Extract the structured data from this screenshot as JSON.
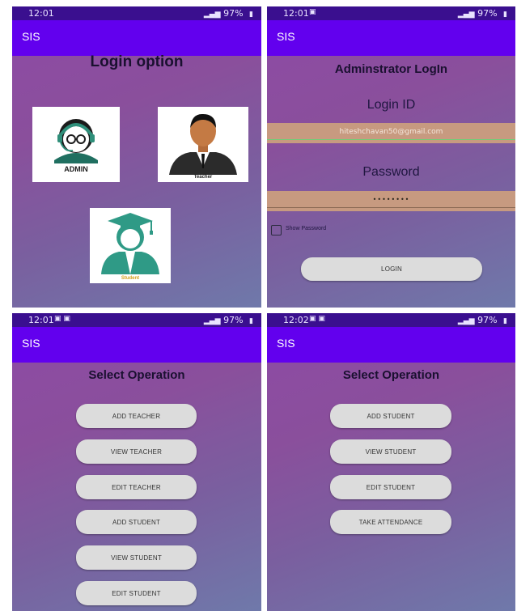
{
  "colors": {
    "status_bar": "#3a0f8f",
    "app_bar": "#6200ee",
    "button_bg": "#dcdcdc",
    "field_bg": "#c79a80",
    "admin_green": "#2f8f7a"
  },
  "screens": [
    {
      "status": {
        "time": "12:01",
        "battery": "97%"
      },
      "app_title": "SIS",
      "heading": "Login option",
      "cards": [
        {
          "caption": "ADMIN",
          "icon": "admin-avatar-icon"
        },
        {
          "caption": "Teacher",
          "icon": "teacher-avatar-icon"
        },
        {
          "caption": "Student",
          "icon": "student-graduate-icon"
        }
      ]
    },
    {
      "status": {
        "time": "12:01",
        "battery": "97%"
      },
      "app_title": "SIS",
      "heading": "Adminstrator LogIn",
      "login_label": "Login ID",
      "login_value": "hiteshchavan50@gmail.com",
      "password_label": "Password",
      "password_value": "••••••••",
      "show_password": "Show Password",
      "login_button": "LOGIN"
    },
    {
      "status": {
        "time": "12:01",
        "battery": "97%"
      },
      "app_title": "SIS",
      "heading": "Select Operation",
      "buttons": [
        "ADD TEACHER",
        "VIEW TEACHER",
        "EDIT TEACHER",
        "ADD STUDENT",
        "VIEW STUDENT",
        "EDIT STUDENT"
      ]
    },
    {
      "status": {
        "time": "12:02",
        "battery": "97%"
      },
      "app_title": "SIS",
      "heading": "Select Operation",
      "buttons": [
        "ADD STUDENT",
        "VIEW STUDENT",
        "EDIT STUDENT",
        "TAKE ATTENDANCE"
      ]
    }
  ]
}
